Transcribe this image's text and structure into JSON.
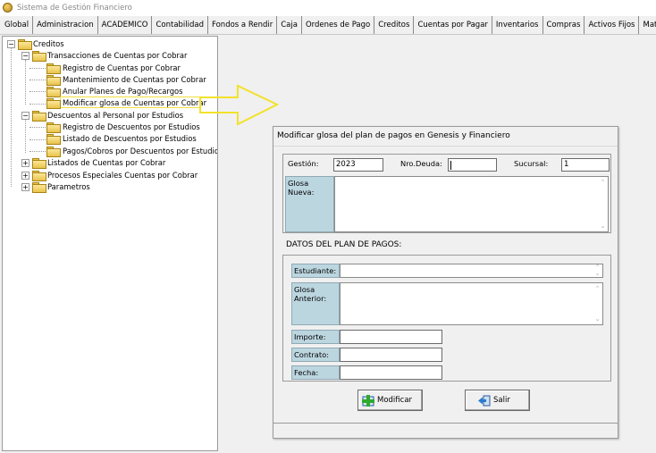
{
  "window": {
    "title": "Sistema de Gestión Financiero"
  },
  "menu": {
    "tabs": [
      "Global",
      "Administracion",
      "ACADEMICO",
      "Contabilidad",
      "Fondos a Rendir",
      "Caja",
      "Ordenes de Pago",
      "Creditos",
      "Cuentas por Pagar",
      "Inventarios",
      "Compras",
      "Activos Fijos",
      "Mater"
    ]
  },
  "tree": {
    "root": "Creditos",
    "transacciones": "Transacciones de Cuentas por Cobrar",
    "registro_cxc": "Registro de Cuentas por Cobrar",
    "mantenimiento_cxc": "Mantenimiento de Cuentas por Cobrar",
    "anular_planes": "Anular Planes de Pago/Recargos",
    "modificar_glosa": "Modificar glosa de Cuentas por Cobrar",
    "descuentos": "Descuentos al Personal por Estudios",
    "registro_desc": "Registro de Descuentos por Estudios",
    "listado_desc": "Listado de Descuentos por Estudios",
    "pagos_cobros": "Pagos/Cobros por Descuentos por Estudios",
    "listados_cxc": "Listados de Cuentas por Cobrar",
    "procesos": "Procesos Especiales Cuentas por Cobrar",
    "parametros": "Parametros"
  },
  "dialog": {
    "title": "Modificar glosa del plan de pagos en Genesis y Financiero",
    "gestion_label": "Gestión:",
    "gestion_value": "2023",
    "nro_deuda_label": "Nro.Deuda:",
    "nro_deuda_value": "",
    "sucursal_label": "Sucursal:",
    "sucursal_value": "1",
    "glosa_nueva_label": "Glosa Nueva:",
    "glosa_nueva_value": "",
    "section_title": "DATOS DEL PLAN DE PAGOS:",
    "estudiante_label": "Estudiante:",
    "estudiante_value": "",
    "glosa_anterior_label": "Glosa Anterior:",
    "glosa_anterior_value": "",
    "importe_label": "Importe:",
    "importe_value": "",
    "contrato_label": "Contrato:",
    "contrato_value": "",
    "fecha_label": "Fecha:",
    "fecha_value": "",
    "modificar_button": "Modificar",
    "salir_button": "Salir"
  },
  "colors": {
    "label_cell": "#bcd6e0",
    "arrow": "#f2e22a",
    "folder": "#e9c44b"
  }
}
